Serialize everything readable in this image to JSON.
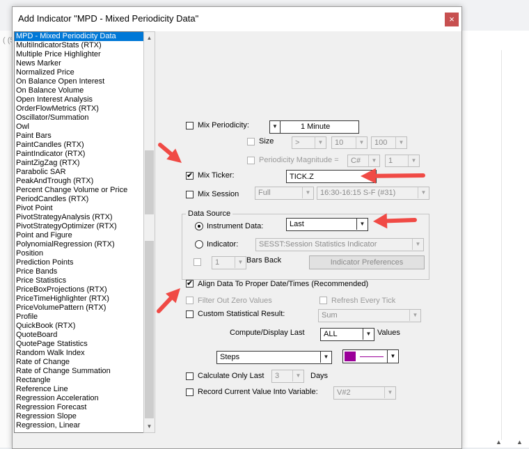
{
  "backdrop": {
    "partial_text": "( (5("
  },
  "dialog": {
    "title": "Add Indicator \"MPD - Mixed Periodicity Data\"",
    "close_glyph": "×"
  },
  "indicator_list": {
    "selected_index": 0,
    "items": [
      "MPD - Mixed Periodicity Data",
      "MultiIndicatorStats (RTX)",
      "Multiple Price Highlighter",
      "News Marker",
      "Normalized Price",
      "On Balance Open Interest",
      "On Balance Volume",
      "Open Interest Analysis",
      "OrderFlowMetrics (RTX)",
      "Oscillator/Summation",
      "Owl",
      "Paint Bars",
      "PaintCandles (RTX)",
      "PaintIndicator (RTX)",
      "PaintZigZag (RTX)",
      "Parabolic SAR",
      "PeakAndTrough (RTX)",
      "Percent Change Volume or Price",
      "PeriodCandles (RTX)",
      "Pivot Point",
      "PivotStrategyAnalysis (RTX)",
      "PivotStrategyOptimizer (RTX)",
      "Point and Figure",
      "PolynomialRegression (RTX)",
      "Position",
      "Prediction Points",
      "Price Bands",
      "Price Statistics",
      "PriceBoxProjections (RTX)",
      "PriceTimeHighlighter (RTX)",
      "PriceVolumePattern (RTX)",
      "Profile",
      "QuickBook (RTX)",
      "QuoteBoard",
      "QuotePage Statistics",
      "Random Walk Index",
      "Rate of Change",
      "Rate of Change Summation",
      "Rectangle",
      "Reference Line",
      "Regression Acceleration",
      "Regression Forecast",
      "Regression Slope",
      "Regression, Linear"
    ]
  },
  "mix_periodicity": {
    "label": "Mix Periodicity:",
    "checked": false,
    "value": "1 Minute",
    "size_label": "Size",
    "size_op": ">",
    "size_val1": "10",
    "size_val2": "100",
    "magnitude_label": "Periodicity Magnitude =",
    "magnitude_var": "C#",
    "magnitude_val": "1"
  },
  "mix_ticker": {
    "label": "Mix Ticker:",
    "checked": true,
    "value": "TICK.Z"
  },
  "mix_session": {
    "label": "Mix Session",
    "checked": false,
    "type": "Full",
    "session": "16:30-16:15 S-F (#31)"
  },
  "data_source": {
    "title": "Data Source",
    "instrument_label": "Instrument Data:",
    "instrument_value": "Last",
    "indicator_label": "Indicator:",
    "indicator_value": "SESST:Session Statistics Indicator",
    "bars_back_value": "1",
    "bars_back_label": "Bars Back",
    "prefs_button": "Indicator Preferences"
  },
  "align": {
    "label": "Align Data To Proper Date/Times (Recommended)",
    "checked": true
  },
  "filter_zero": {
    "label": "Filter Out Zero Values",
    "checked": false
  },
  "refresh_tick": {
    "label": "Refresh Every Tick",
    "checked": false
  },
  "custom_stat": {
    "label": "Custom Statistical Result:",
    "checked": false,
    "value": "Sum"
  },
  "compute": {
    "label": "Compute/Display Last",
    "value": "ALL",
    "suffix": "Values"
  },
  "draw": {
    "style": "Steps",
    "color": "#9a0099"
  },
  "calc_only": {
    "label": "Calculate Only Last",
    "checked": false,
    "value": "3",
    "suffix": "Days"
  },
  "record": {
    "label": "Record Current Value Into Variable:",
    "checked": false,
    "value": "V#2"
  },
  "glyphs": {
    "check": "✔",
    "arrow_down": "▼",
    "arrow_up": "▲"
  },
  "annotation_color": "#f04a45"
}
